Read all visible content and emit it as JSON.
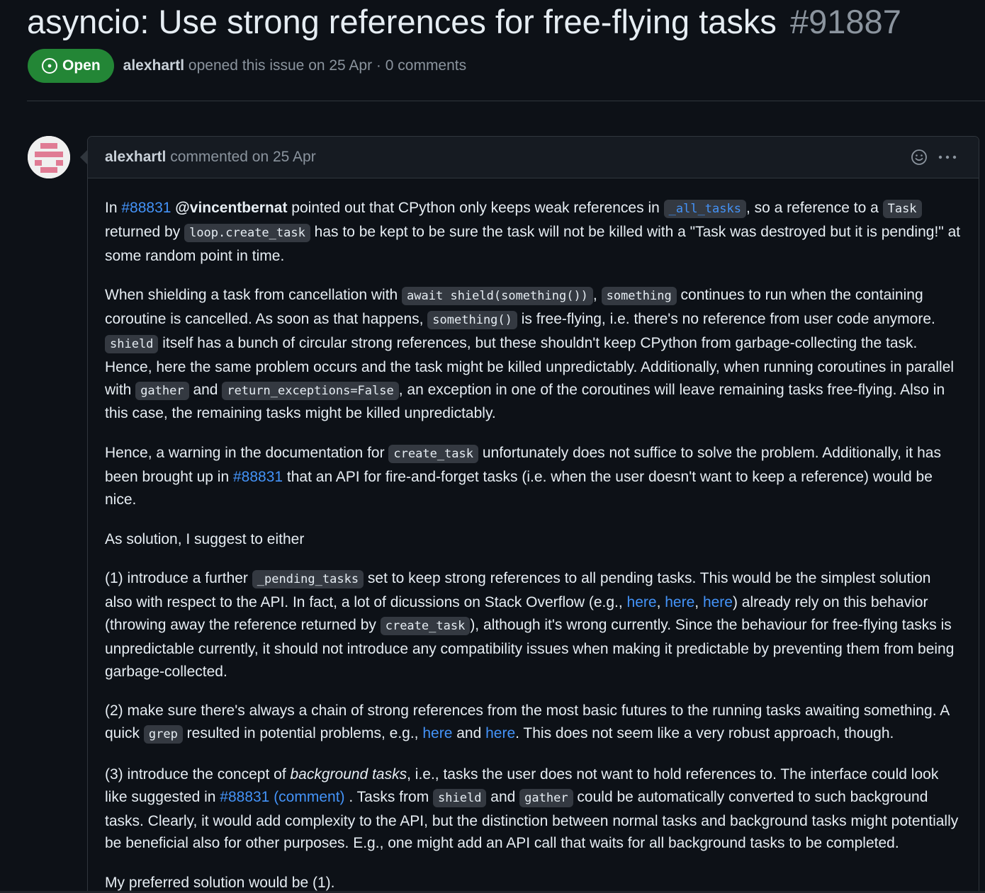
{
  "issue": {
    "title": "asyncio: Use strong references for free-flying tasks",
    "number": "#91887",
    "state": "Open",
    "author": "alexhartl",
    "meta_rest": "opened this issue on 25 Apr · 0 comments"
  },
  "colors": {
    "background": "#0d1117",
    "open_green": "#238636",
    "link": "#4493f8",
    "border": "#30363d"
  },
  "comment": {
    "author": "alexhartl",
    "meta": "commented on 25 Apr",
    "icons": [
      "smiley-icon",
      "kebab-menu-icon"
    ],
    "p1": {
      "t1": "In ",
      "issue_link": "#88831",
      "mention": "@vincentbernat",
      "t2": " pointed out that CPython only keeps weak references in ",
      "c1": "_all_tasks",
      "t3": ", so a reference to a ",
      "c2": "Task",
      "t4": " returned by ",
      "c3": "loop.create_task",
      "t5": " has to be kept to be sure the task will not be killed with a \"Task was destroyed but it is pending!\" at some random point in time."
    },
    "p2": {
      "t1": "When shielding a task from cancellation with ",
      "c1": "await shield(something())",
      "t2": ", ",
      "c2": "something",
      "t3": " continues to run when the containing coroutine is cancelled. As soon as that happens, ",
      "c3": "something()",
      "t4": " is free-flying, i.e. there's no reference from user code anymore. ",
      "c4": "shield",
      "t5": " itself has a bunch of circular strong references, but these shouldn't keep CPython from garbage-collecting the task. Hence, here the same problem occurs and the task might be killed unpredictably. Additionally, when running coroutines in parallel with ",
      "c5": "gather",
      "t6": " and ",
      "c6": "return_exceptions=False",
      "t7": ", an exception in one of the coroutines will leave remaining tasks free-flying. Also in this case, the remaining tasks might be killed unpredictably."
    },
    "p3": {
      "t1": "Hence, a warning in the documentation for ",
      "c1": "create_task",
      "t2": " unfortunately does not suffice to solve the problem. Additionally, it has been brought up in ",
      "issue_link": "#88831",
      "t3": " that an API for fire-and-forget tasks (i.e. when the user doesn't want to keep a reference) would be nice."
    },
    "p4": {
      "t1": "As solution, I suggest to either"
    },
    "p5": {
      "t1": "(1) introduce a further ",
      "c1": "_pending_tasks",
      "t2": " set to keep strong references to all pending tasks. This would be the simplest solution also with respect to the API. In fact, a lot of dicussions on Stack Overflow (e.g., ",
      "link1": "here",
      "sep1": ", ",
      "link2": "here",
      "sep2": ", ",
      "link3": "here",
      "t3": ") already rely on this behavior (throwing away the reference returned by ",
      "c2": "create_task",
      "t4": "), although it's wrong currently. Since the behaviour for free-flying tasks is unpredictable currently, it should not introduce any compatibility issues when making it predictable by preventing them from being garbage-collected."
    },
    "p6": {
      "t1": "(2) make sure there's always a chain of strong references from the most basic futures to the running tasks awaiting something. A quick ",
      "c1": "grep",
      "t2": " resulted in potential problems, e.g., ",
      "link1": "here",
      "t3": " and ",
      "link2": "here",
      "t4": ". This does not seem like a very robust approach, though."
    },
    "p7": {
      "t1": "(3) introduce the concept of ",
      "em": "background tasks",
      "t2": ", i.e., tasks the user does not want to hold references to. The interface could look like suggested in ",
      "issue_link": "#88831 (comment)",
      "t3": " . Tasks from ",
      "c1": "shield",
      "t4": " and ",
      "c2": "gather",
      "t5": " could be automatically converted to such background tasks. Clearly, it would add complexity to the API, but the distinction between normal tasks and background tasks might potentially be beneficial also for other purposes. E.g., one might add an API call that waits for all background tasks to be completed."
    },
    "p8": {
      "t1": "My preferred solution would be (1)."
    }
  }
}
